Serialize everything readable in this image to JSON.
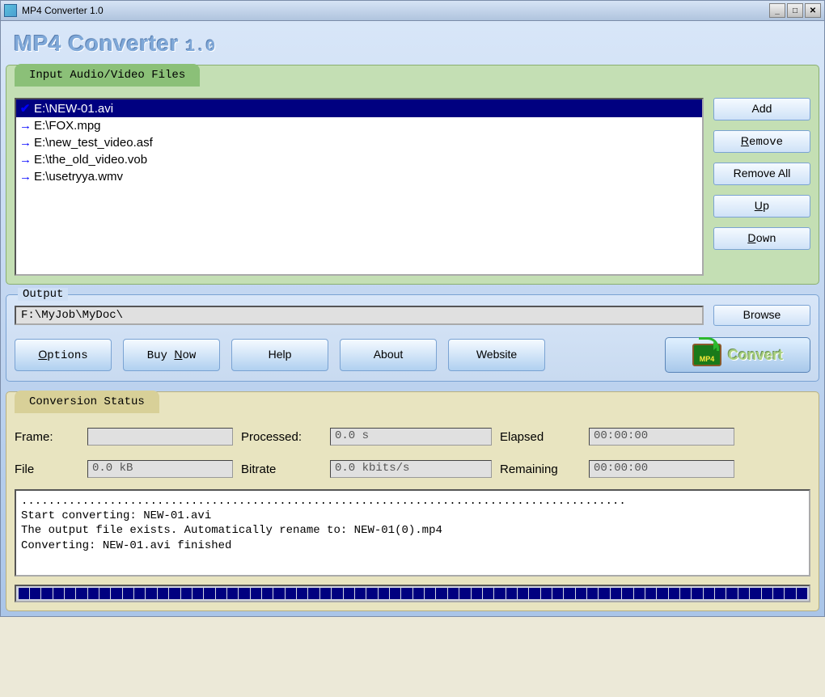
{
  "window": {
    "title": "MP4 Converter 1.0"
  },
  "app": {
    "title": "MP4 Converter",
    "version": "1.0"
  },
  "input": {
    "tab_label": "Input Audio/Video Files",
    "files": [
      {
        "path": "E:\\NEW-01.avi",
        "checked": true,
        "selected": true
      },
      {
        "path": "E:\\FOX.mpg",
        "checked": false,
        "selected": false
      },
      {
        "path": "E:\\new_test_video.asf",
        "checked": false,
        "selected": false
      },
      {
        "path": "E:\\the_old_video.vob",
        "checked": false,
        "selected": false
      },
      {
        "path": "E:\\usetryya.wmv",
        "checked": false,
        "selected": false
      }
    ],
    "buttons": {
      "add": "Add",
      "remove": "Remove",
      "remove_all": "Remove All",
      "up": "Up",
      "down": "Down"
    }
  },
  "output": {
    "label": "Output",
    "path": "F:\\MyJob\\MyDoc\\",
    "browse": "Browse"
  },
  "actions": {
    "options": "Options",
    "buy_now": "Buy Now",
    "help": "Help",
    "about": "About",
    "website": "Website",
    "convert_icon": "MP4",
    "convert": "Convert"
  },
  "status": {
    "tab_label": "Conversion Status",
    "labels": {
      "frame": "Frame:",
      "processed": "Processed:",
      "elapsed": "Elapsed",
      "file": "File",
      "bitrate": "Bitrate",
      "remaining": "Remaining"
    },
    "values": {
      "frame": "",
      "processed": "0.0 s",
      "elapsed": "00:00:00",
      "file": "0.0 kB",
      "bitrate": "0.0 kbits/s",
      "remaining": "00:00:00"
    },
    "log": ".........................................................................................\nStart converting: NEW-01.avi\nThe output file exists. Automatically rename to: NEW-01(0).mp4\nConverting: NEW-01.avi finished"
  }
}
